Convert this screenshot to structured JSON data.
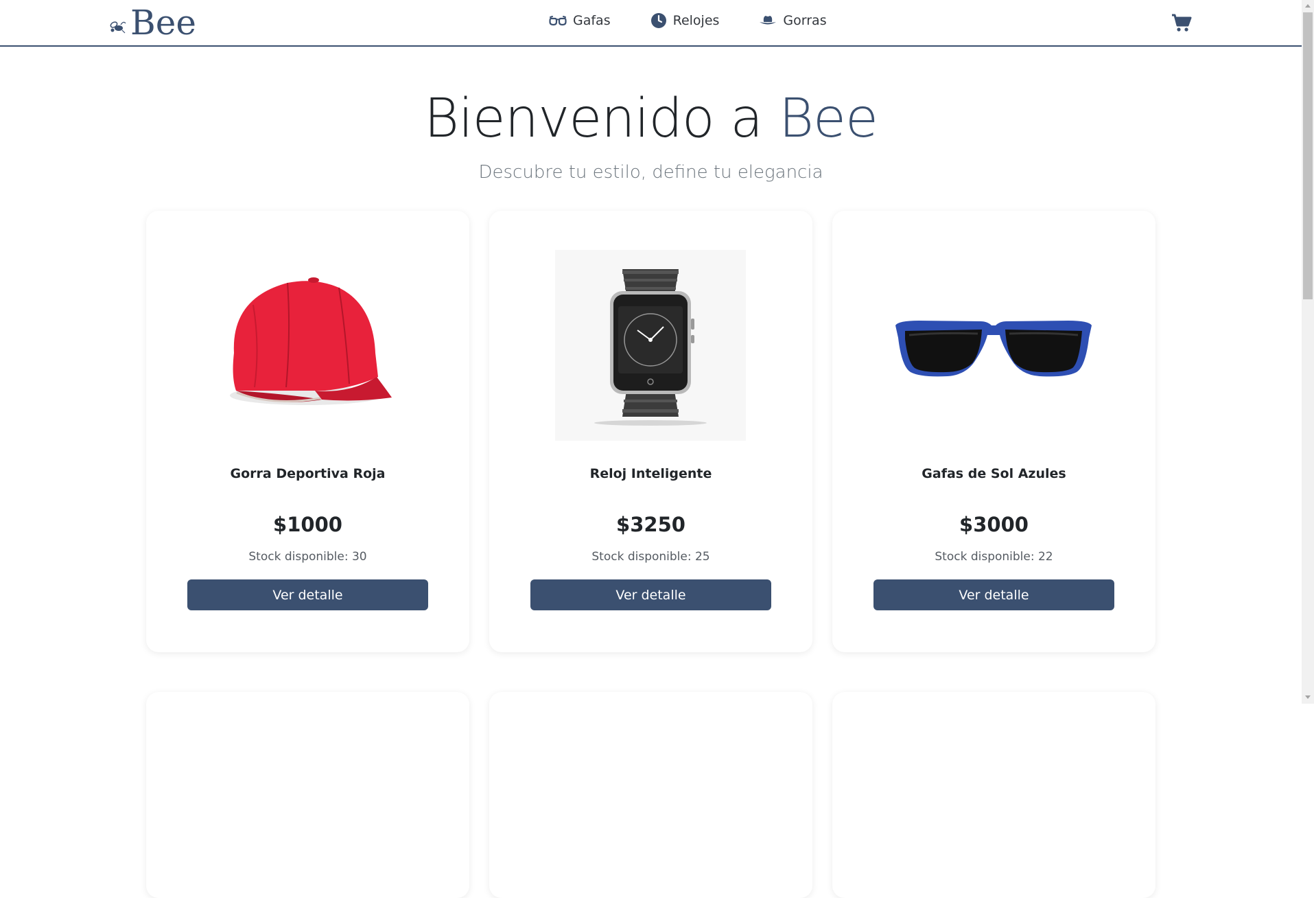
{
  "brand": {
    "name": "Bee"
  },
  "nav": {
    "items": [
      {
        "label": "Gafas",
        "icon": "glasses-icon"
      },
      {
        "label": "Relojes",
        "icon": "clock-icon"
      },
      {
        "label": "Gorras",
        "icon": "hat-icon"
      }
    ],
    "cart_icon": "cart-icon"
  },
  "hero": {
    "title_prefix": "Bienvenido a",
    "title_accent": "Bee",
    "subtitle": "Descubre tu estilo, define tu elegancia"
  },
  "colors": {
    "accent": "#3b5070",
    "text": "#212529",
    "muted": "#6c757d"
  },
  "products": [
    {
      "name": "Gorra Deportiva Roja",
      "price": "$1000",
      "stock": "Stock disponible: 30",
      "button": "Ver detalle",
      "image": "red-cap"
    },
    {
      "name": "Reloj Inteligente",
      "price": "$3250",
      "stock": "Stock disponible: 25",
      "button": "Ver detalle",
      "image": "smart-watch"
    },
    {
      "name": "Gafas de Sol Azules",
      "price": "$3000",
      "stock": "Stock disponible: 22",
      "button": "Ver detalle",
      "image": "blue-sunglasses"
    }
  ]
}
